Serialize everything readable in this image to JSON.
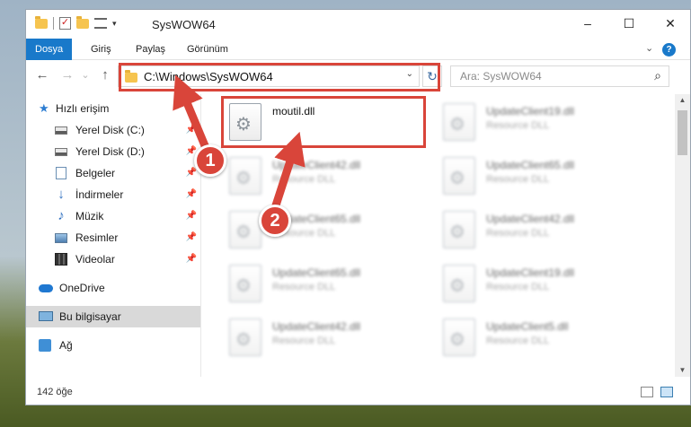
{
  "window": {
    "title": "SysWOW64",
    "min_glyph": "–",
    "max_glyph": "☐",
    "close_glyph": "✕",
    "qa_check": "✓",
    "qa_caret": "▾"
  },
  "ribbon": {
    "tabs": [
      {
        "label": "Dosya",
        "active": true
      },
      {
        "label": "Giriş",
        "active": false
      },
      {
        "label": "Paylaş",
        "active": false
      },
      {
        "label": "Görünüm",
        "active": false
      }
    ],
    "expand_glyph": "⌄",
    "help_glyph": "?"
  },
  "nav": {
    "back_glyph": "←",
    "forward_glyph": "→",
    "recent_glyph": "⌄",
    "up_glyph": "↑",
    "address": "C:\\Windows\\SysWOW64",
    "address_drop": "⌄",
    "refresh_glyph": "↻",
    "search_placeholder": "Ara: SysWOW64",
    "search_glyph": "⌕"
  },
  "sidebar": {
    "items": [
      {
        "label": "Hızlı erişim",
        "icon": "star-icon",
        "pinned": false
      },
      {
        "label": "Yerel Disk (C:)",
        "icon": "drive-icon",
        "pinned": true
      },
      {
        "label": "Yerel Disk (D:)",
        "icon": "drive-icon",
        "pinned": true
      },
      {
        "label": "Belgeler",
        "icon": "documents-icon",
        "pinned": true
      },
      {
        "label": "İndirmeler",
        "icon": "downloads-icon",
        "pinned": true
      },
      {
        "label": "Müzik",
        "icon": "music-icon",
        "pinned": true
      },
      {
        "label": "Resimler",
        "icon": "pictures-icon",
        "pinned": true
      },
      {
        "label": "Videolar",
        "icon": "videos-icon",
        "pinned": true
      },
      {
        "label": "OneDrive",
        "icon": "onedrive-icon",
        "pinned": false
      },
      {
        "label": "Bu bilgisayar",
        "icon": "this-pc-icon",
        "pinned": false,
        "selected": true
      },
      {
        "label": "Ağ",
        "icon": "network-icon",
        "pinned": false
      }
    ],
    "pin_glyph": "📌",
    "star_glyph": "★",
    "download_glyph": "↓",
    "music_glyph": "♪"
  },
  "files": [
    {
      "name": "moutil.dll",
      "type": ""
    },
    {
      "name": "UpdateClient19.dll",
      "type": "Resource DLL"
    },
    {
      "name": "UpdateClient42.dll",
      "type": "Resource DLL"
    },
    {
      "name": "UpdateClient65.dll",
      "type": "Resource DLL"
    },
    {
      "name": "UpdateClient65.dll",
      "type": "Resource DLL"
    },
    {
      "name": "UpdateClient42.dll",
      "type": "Resource DLL"
    },
    {
      "name": "UpdateClient65.dll",
      "type": "Resource DLL"
    },
    {
      "name": "UpdateClient19.dll",
      "type": "Resource DLL"
    },
    {
      "name": "UpdateClient42.dll",
      "type": "Resource DLL"
    },
    {
      "name": "UpdateClient5.dll",
      "type": "Resource DLL"
    }
  ],
  "scroll": {
    "up_glyph": "▲",
    "down_glyph": "▼"
  },
  "status": {
    "count": "142 öğe"
  },
  "annotations": {
    "color": "#d9453a",
    "badges": [
      "1",
      "2"
    ]
  }
}
